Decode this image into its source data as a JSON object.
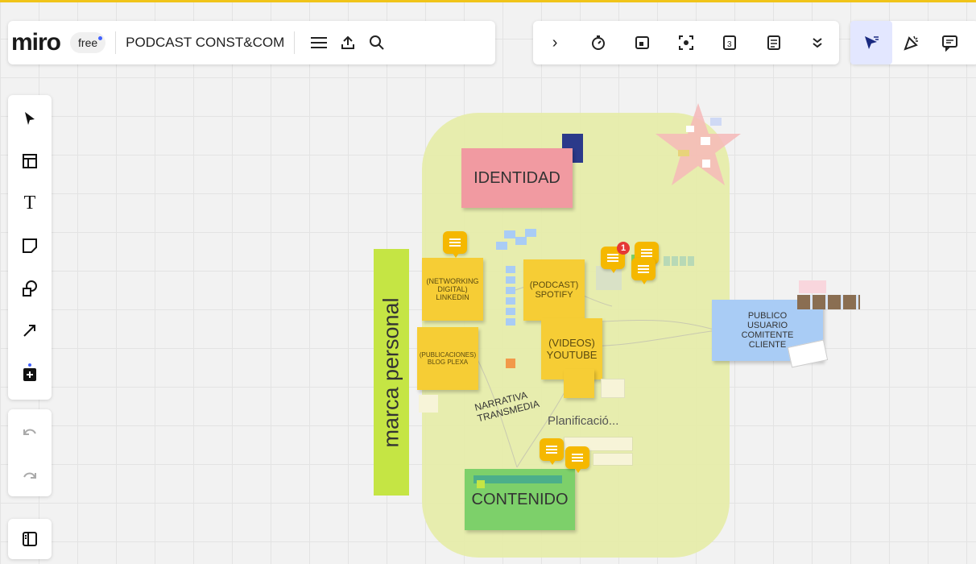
{
  "app": {
    "logo": "miro",
    "plan": "free",
    "board_title": "PODCAST CONST&COM"
  },
  "top_toolbar": {
    "left_icons": [
      "menu-icon",
      "upload-icon",
      "search-icon"
    ],
    "mid_icons": [
      "chevron-right-icon",
      "timer-icon",
      "comment-card-icon",
      "focus-icon",
      "counter-icon",
      "notes-icon",
      "chevron-double-down-icon"
    ],
    "right_icons": [
      "select-cursor-icon",
      "celebrate-icon",
      "chat-icon"
    ]
  },
  "left_toolbar": {
    "tools": [
      "select-icon",
      "templates-icon",
      "text-icon",
      "sticky-note-icon",
      "shapes-icon",
      "arrow-icon",
      "add-more-icon"
    ],
    "history": [
      "undo-icon",
      "redo-icon"
    ],
    "panel": "panel-icon"
  },
  "board": {
    "vertical_label": "marca personal",
    "stickies": {
      "identidad": "IDENTIDAD",
      "networking": "(NETWORKING DIGITAL) LINKEDIN",
      "podcast": "(PODCAST) SPOTIFY",
      "publicaciones": "(PUBLICACIONES) BLOG PLEXA",
      "videos": "(VIDEOS) YOUTUBE",
      "publico": "PUBLICO USUARIO COMITENTE CLIENTE",
      "contenido": "CONTENIDO"
    },
    "texts": {
      "narrativa": "NARRATIVA TRANSMEDIA",
      "planificacion": "Planificació..."
    },
    "notification_count": "1",
    "colors": {
      "accent_line": "#f0c419",
      "area": "#e6ecaa",
      "identidad": "#f19aa1",
      "contenido": "#7dd06a",
      "publico": "#a9ccf5",
      "yellow_note": "#f6cd35",
      "marca_label": "#c5e544"
    }
  }
}
